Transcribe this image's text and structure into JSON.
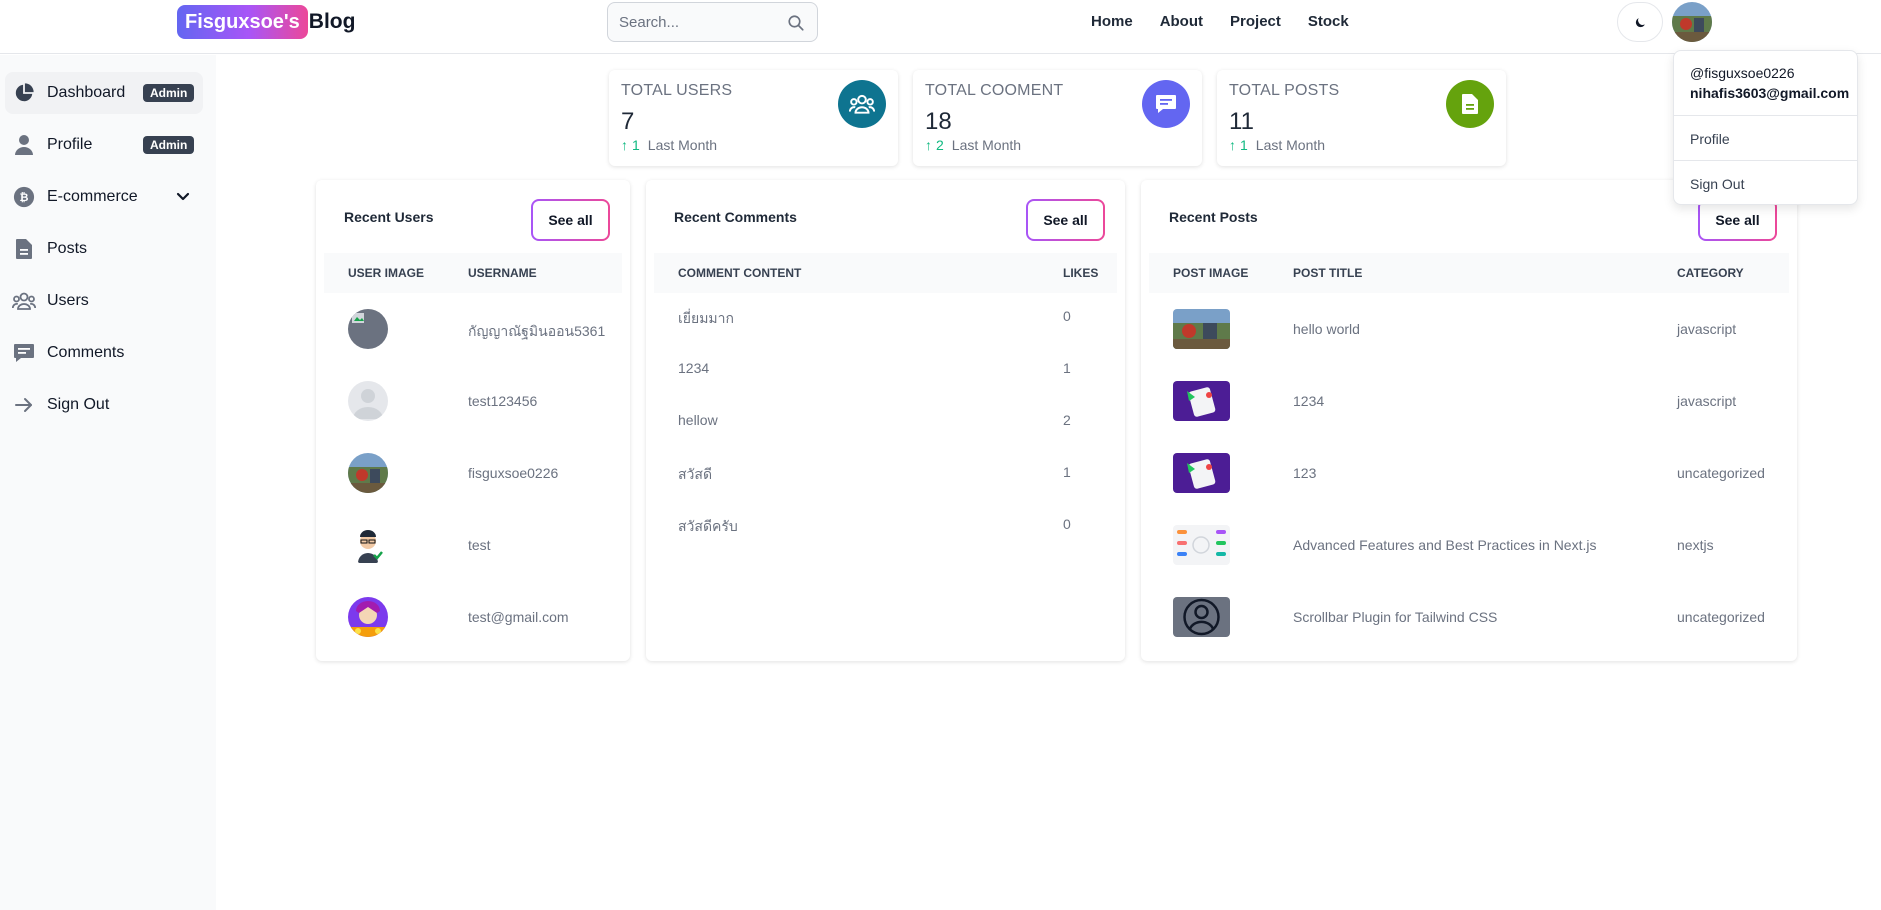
{
  "header": {
    "logo_badge": "Fisguxsoe's",
    "logo_text": "Blog",
    "search_placeholder": "Search...",
    "nav": [
      "Home",
      "About",
      "Project",
      "Stock"
    ]
  },
  "sidebar": {
    "items": [
      {
        "label": "Dashboard",
        "badge": "Admin",
        "icon": "pie-chart-icon"
      },
      {
        "label": "Profile",
        "badge": "Admin",
        "icon": "user-icon"
      },
      {
        "label": "E-commerce",
        "icon": "bitcoin-icon"
      },
      {
        "label": "Posts",
        "icon": "document-icon"
      },
      {
        "label": "Users",
        "icon": "users-icon"
      },
      {
        "label": "Comments",
        "icon": "comment-icon"
      },
      {
        "label": "Sign Out",
        "icon": "arrow-right-icon"
      }
    ]
  },
  "stats": [
    {
      "title": "TOTAL USERS",
      "value": "7",
      "change": "1",
      "period": "Last Month",
      "color": "#0e7490",
      "icon": "users-icon"
    },
    {
      "title": "TOTAL COOMENT",
      "value": "18",
      "change": "2",
      "period": "Last Month",
      "color": "#6366f1",
      "icon": "comment-icon"
    },
    {
      "title": "TOTAL POSTS",
      "value": "11",
      "change": "1",
      "period": "Last Month",
      "color": "#65a30d",
      "icon": "document-icon"
    }
  ],
  "recent_users": {
    "title": "Recent Users",
    "see_all": "See all",
    "columns": [
      "USER IMAGE",
      "USERNAME"
    ],
    "rows": [
      {
        "username": "กัญญาณัฐมินออน5361"
      },
      {
        "username": "test123456"
      },
      {
        "username": "fisguxsoe0226"
      },
      {
        "username": "test"
      },
      {
        "username": "test@gmail.com"
      }
    ]
  },
  "recent_comments": {
    "title": "Recent Comments",
    "see_all": "See all",
    "columns": [
      "COMMENT CONTENT",
      "LIKES"
    ],
    "rows": [
      {
        "content": "เยี่ยมมาก",
        "likes": "0"
      },
      {
        "content": "1234",
        "likes": "1"
      },
      {
        "content": "hellow",
        "likes": "2"
      },
      {
        "content": "สวัสดี",
        "likes": "1"
      },
      {
        "content": "สวัสดีครับ",
        "likes": "0"
      }
    ]
  },
  "recent_posts": {
    "title": "Recent Posts",
    "see_all": "See all",
    "columns": [
      "POST IMAGE",
      "POST TITLE",
      "CATEGORY"
    ],
    "rows": [
      {
        "title": "hello world",
        "category": "javascript"
      },
      {
        "title": "1234",
        "category": "javascript"
      },
      {
        "title": "123",
        "category": "uncategorized"
      },
      {
        "title": "Advanced Features and Best Practices in Next.js",
        "category": "nextjs"
      },
      {
        "title": "Scrollbar Plugin for Tailwind CSS",
        "category": "uncategorized"
      }
    ]
  },
  "dropdown": {
    "username": "@fisguxsoe0226",
    "email": "nihafis3603@gmail.com",
    "items": [
      "Profile",
      "Sign Out"
    ]
  }
}
